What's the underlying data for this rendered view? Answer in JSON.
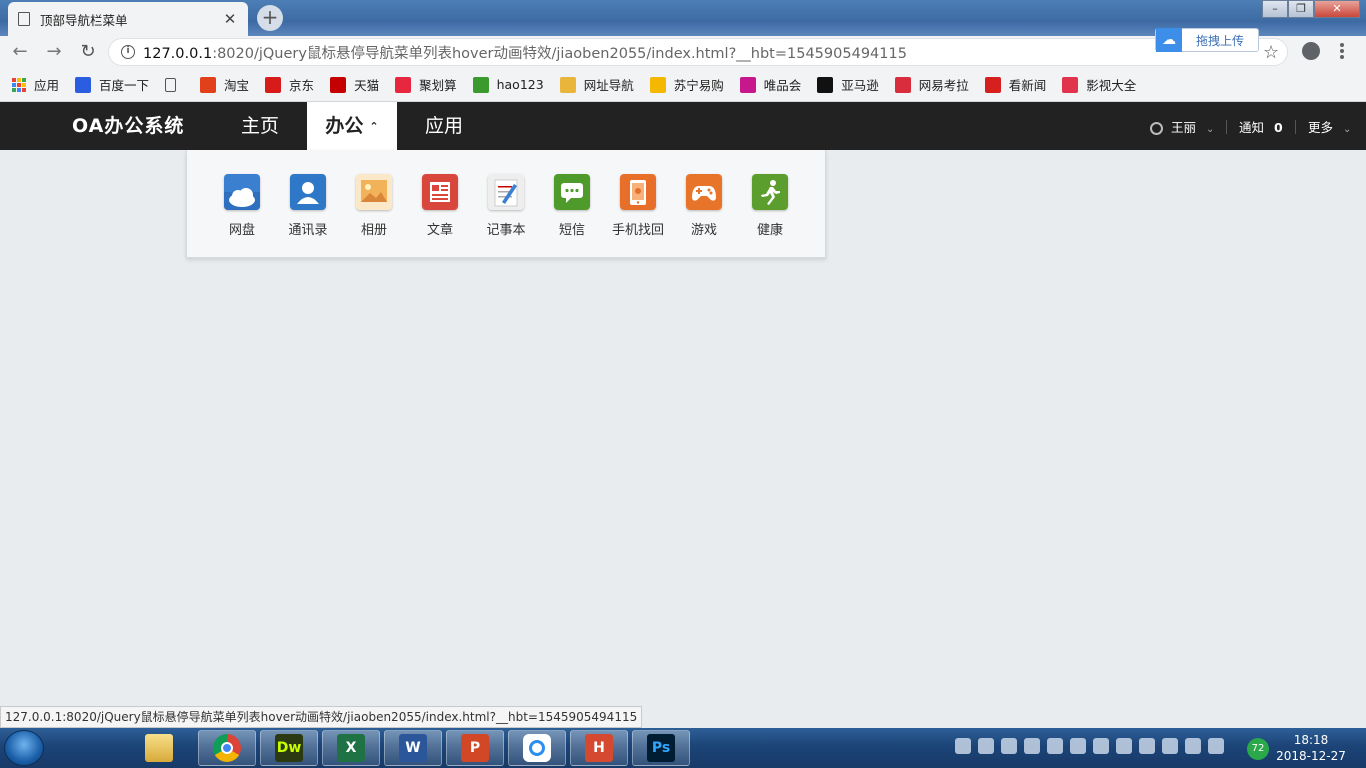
{
  "browser": {
    "tab_title": "顶部导航栏菜单",
    "url_host": "127.0.0.1",
    "url_rest": ":8020/jQuery鼠标悬停导航菜单列表hover动画特效/jiaoben2055/index.html?__hbt=1545905494115",
    "upload_label": "拖拽上传",
    "status_url": "127.0.0.1:8020/jQuery鼠标悬停导航菜单列表hover动画特效/jiaoben2055/index.html?__hbt=1545905494115"
  },
  "bookmarks": [
    {
      "label": "应用",
      "icon": "apps-grid-icon"
    },
    {
      "label": "百度一下",
      "icon": "baidu-icon",
      "color": "#2b5de0"
    },
    {
      "label": "",
      "icon": "page-icon"
    },
    {
      "label": "淘宝",
      "icon": "taobao-icon",
      "color": "#e2401a"
    },
    {
      "label": "京东",
      "icon": "jd-icon",
      "color": "#d71a1a"
    },
    {
      "label": "天猫",
      "icon": "tmall-icon",
      "color": "#c40000"
    },
    {
      "label": "聚划算",
      "icon": "juhuasuan-icon",
      "color": "#e7263f"
    },
    {
      "label": "hao123",
      "icon": "hao123-icon",
      "color": "#3a9a2e"
    },
    {
      "label": "网址导航",
      "icon": "7654-icon",
      "color": "#e9b53a"
    },
    {
      "label": "苏宁易购",
      "icon": "suning-icon",
      "color": "#f5b800"
    },
    {
      "label": "唯品会",
      "icon": "vip-icon",
      "color": "#c7178d"
    },
    {
      "label": "亚马逊",
      "icon": "amazon-icon",
      "color": "#111111"
    },
    {
      "label": "网易考拉",
      "icon": "kaola-icon",
      "color": "#d92c3d"
    },
    {
      "label": "看新闻",
      "icon": "news-icon",
      "color": "#d62020"
    },
    {
      "label": "影视大全",
      "icon": "video-icon",
      "color": "#e2334d"
    }
  ],
  "app": {
    "brand": "OA办公系统",
    "nav": [
      "主页",
      "办公",
      "应用"
    ],
    "user": "王丽",
    "notify_label": "通知",
    "notify_count": "0",
    "more_label": "更多"
  },
  "office_apps": [
    {
      "label": "网盘",
      "icon": "cloud-disk-icon",
      "color": "#3a7fd0"
    },
    {
      "label": "通讯录",
      "icon": "contacts-icon",
      "color": "#2f78c8"
    },
    {
      "label": "相册",
      "icon": "photo-album-icon",
      "color": "#f0c070"
    },
    {
      "label": "文章",
      "icon": "article-icon",
      "color": "#d9473c"
    },
    {
      "label": "记事本",
      "icon": "notepad-icon",
      "color": "#e8e8e8"
    },
    {
      "label": "短信",
      "icon": "sms-icon",
      "color": "#4e9a2a"
    },
    {
      "label": "手机找回",
      "icon": "phone-find-icon",
      "color": "#e76f2a"
    },
    {
      "label": "游戏",
      "icon": "game-icon",
      "color": "#e8742a"
    },
    {
      "label": "健康",
      "icon": "health-icon",
      "color": "#5c9e2e"
    }
  ],
  "taskbar": {
    "apps": [
      {
        "icon": "file-explorer-icon",
        "text": ""
      },
      {
        "icon": "chrome-icon",
        "text": ""
      },
      {
        "icon": "dreamweaver-icon",
        "text": "Dw",
        "color": "#2b3a10",
        "fg": "#c7ff00"
      },
      {
        "icon": "excel-icon",
        "text": "X",
        "color": "#1f7244"
      },
      {
        "icon": "word-icon",
        "text": "W",
        "color": "#2b579a"
      },
      {
        "icon": "powerpoint-icon",
        "text": "P",
        "color": "#d24726"
      },
      {
        "icon": "baidu-netdisk-icon",
        "text": ""
      },
      {
        "icon": "hbuilder-icon",
        "text": "H",
        "color": "#d4492f"
      },
      {
        "icon": "photoshop-icon",
        "text": "Ps",
        "color": "#001d34",
        "fg": "#31a8ff"
      }
    ],
    "tray_badge": "72",
    "time": "18:18",
    "date": "2018-12-27"
  }
}
